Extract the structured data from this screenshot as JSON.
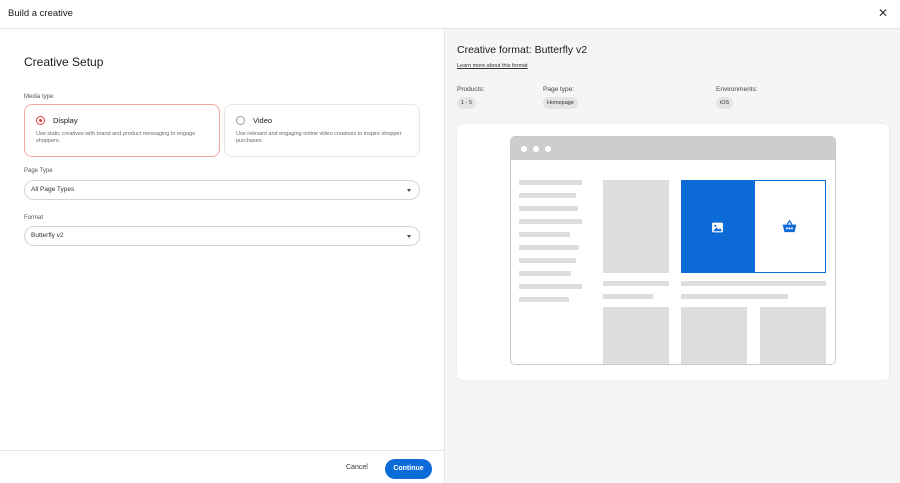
{
  "header": {
    "title": "Build a creative",
    "close_icon": "close-icon"
  },
  "setup": {
    "title": "Creative Setup",
    "media_type_label": "Media type",
    "media_options": [
      {
        "label": "Display",
        "desc": "Use static creatives with brand and product messaging to engage shoppers.",
        "selected": true
      },
      {
        "label": "Video",
        "desc": "Use relevant and engaging online video creatives to inspire shopper purchases.",
        "selected": false
      }
    ],
    "page_type_label": "Page Type",
    "page_type_value": "All Page Types",
    "format_label": "Format",
    "format_value": "Butterfly v2"
  },
  "footer": {
    "cancel": "Cancel",
    "continue": "Continue"
  },
  "format_panel": {
    "title": "Creative format: Butterfly v2",
    "learn_more": "Learn more about this format",
    "products_label": "Products:",
    "products_value": "1 - 5",
    "page_type_label": "Page type:",
    "page_type_value": "Homepage",
    "environments_label": "Environments:",
    "environments_value": "iOS"
  },
  "colors": {
    "accent": "#0d6bd8",
    "selected_radio": "#e0413a"
  },
  "icons": {
    "image": "image-icon",
    "basket": "basket-icon"
  }
}
